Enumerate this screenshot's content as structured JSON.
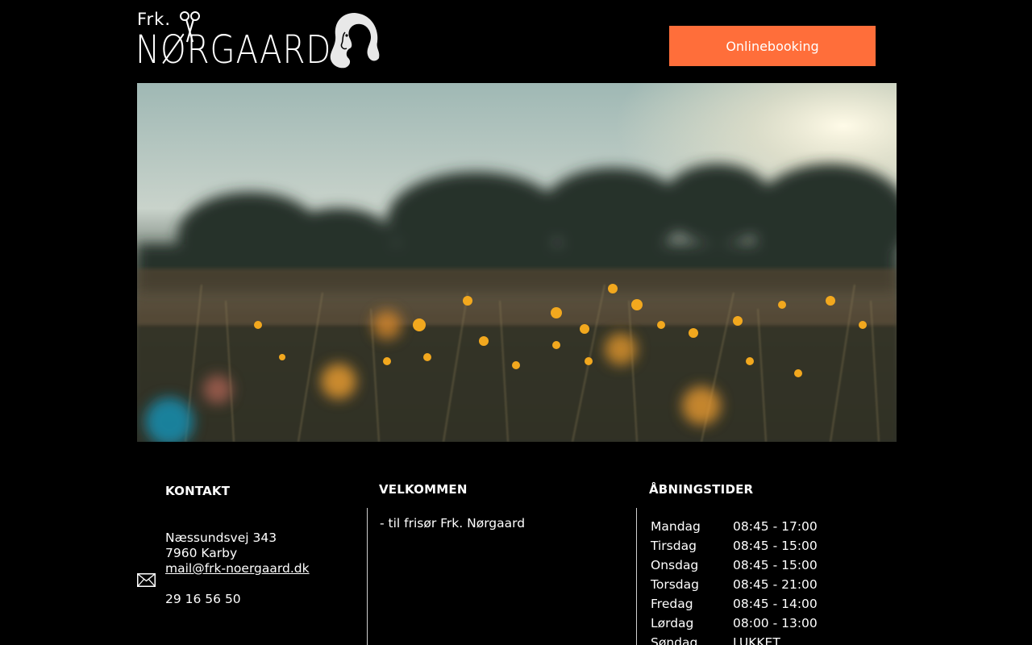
{
  "header": {
    "logo_small": "Frk.",
    "logo_name": "NØRGAARD",
    "booking_label": "Onlinebooking"
  },
  "kontakt": {
    "title": "KONTAKT",
    "address_line1": "Næssundsvej 343",
    "address_line2": "7960 Karby",
    "email": "mail@frk-noergaard.dk",
    "phone": "29 16 56 50"
  },
  "velkommen": {
    "title": "VELKOMMEN",
    "text": "- til frisør Frk. Nørgaard"
  },
  "abningstider": {
    "title": "ÅBNINGSTIDER",
    "rows": [
      {
        "day": "Mandag",
        "time": "08:45 - 17:00"
      },
      {
        "day": "Tirsdag",
        "time": "08:45 - 15:00"
      },
      {
        "day": "Onsdag",
        "time": "08:45 - 15:00"
      },
      {
        "day": "Torsdag",
        "time": "08:45 - 21:00"
      },
      {
        "day": "Fredag",
        "time": "08:45 - 14:00"
      },
      {
        "day": "Lørdag",
        "time": "08:00 - 13:00"
      },
      {
        "day": "Søndag",
        "time": "LUKKET"
      }
    ]
  },
  "colors": {
    "background": "#000000",
    "accent": "#ff6e3a",
    "text": "#ffffff"
  },
  "icons": {
    "mail": "envelope-icon",
    "logo_scissors": "scissors-icon",
    "logo_face": "woman-face-icon"
  }
}
